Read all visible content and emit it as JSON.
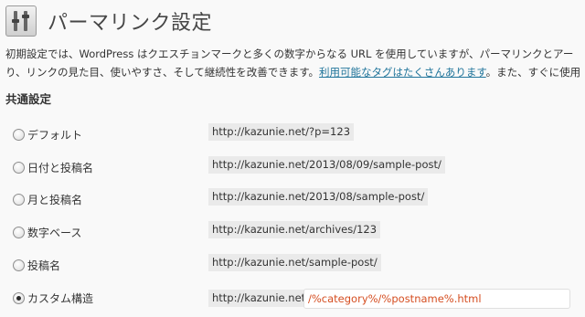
{
  "page": {
    "title": "パーマリンク設定",
    "icon": "settings-icon"
  },
  "intro": {
    "line1": "初期設定では、WordPress はクエスチョンマークと多くの数字からなる URL を使用していますが、パーマリンクとアー",
    "line2_before": "り、リンクの見た目、使いやすさ、そして継続性を改善できます。",
    "link_text": "利用可能なタグはたくさんあります",
    "line2_after": "。また、すぐに使用"
  },
  "common": {
    "section_title": "共通設定",
    "options": [
      {
        "label": "デフォルト",
        "example": "http://kazunie.net/?p=123",
        "checked": false
      },
      {
        "label": "日付と投稿名",
        "example": "http://kazunie.net/2013/08/09/sample-post/",
        "checked": false
      },
      {
        "label": "月と投稿名",
        "example": "http://kazunie.net/2013/08/sample-post/",
        "checked": false
      },
      {
        "label": "数字ベース",
        "example": "http://kazunie.net/archives/123",
        "checked": false
      },
      {
        "label": "投稿名",
        "example": "http://kazunie.net/sample-post/",
        "checked": false
      },
      {
        "label": "カスタム構造",
        "example": "http://kazunie.net",
        "checked": true
      }
    ],
    "custom_structure_value": "/%category%/%postname%.html"
  },
  "colors": {
    "link": "#21759b",
    "input_text": "#d54e21",
    "code_background": "#eaeaea",
    "page_background": "#f9f9f9"
  }
}
